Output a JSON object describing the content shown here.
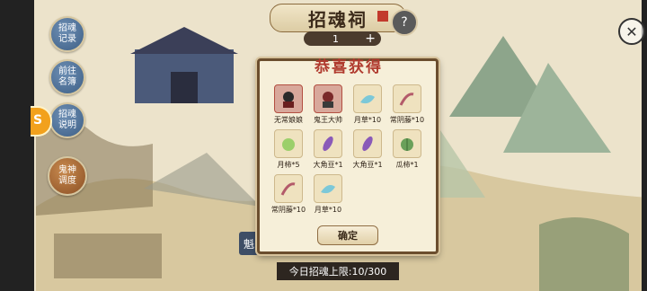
{
  "header": {
    "title": "招魂祠",
    "counter_value": "1",
    "plus_label": "+"
  },
  "side_menu": [
    {
      "label": "招魂记录"
    },
    {
      "label": "前往名簿"
    },
    {
      "label": "招魂说明"
    },
    {
      "label": "鬼神调度"
    }
  ],
  "dialog": {
    "title": "恭喜获得",
    "confirm_label": "确定",
    "items": [
      {
        "name": "无常娘娘",
        "icon": "ghost-lady-icon"
      },
      {
        "name": "鬼王大帅",
        "icon": "ghost-king-icon"
      },
      {
        "name": "月草*10",
        "icon": "moon-grass-icon"
      },
      {
        "name": "常阴藤*10",
        "icon": "vine-icon"
      },
      {
        "name": "月柿*5",
        "icon": "persimmon-icon"
      },
      {
        "name": "大角豆*1",
        "icon": "bean-icon"
      },
      {
        "name": "大角豆*1",
        "icon": "bean-icon"
      },
      {
        "name": "瓜柿*1",
        "icon": "melon-icon"
      },
      {
        "name": "常阴藤*10",
        "icon": "vine-icon"
      },
      {
        "name": "月草*10",
        "icon": "moon-grass-icon"
      }
    ]
  },
  "footer": {
    "limit_text": "今日招魂上限:10/300",
    "tab_label": "魁"
  },
  "colors": {
    "dialog_title": "#b03a2e",
    "panel": "#f6efd9",
    "border": "#6b4e2e"
  }
}
